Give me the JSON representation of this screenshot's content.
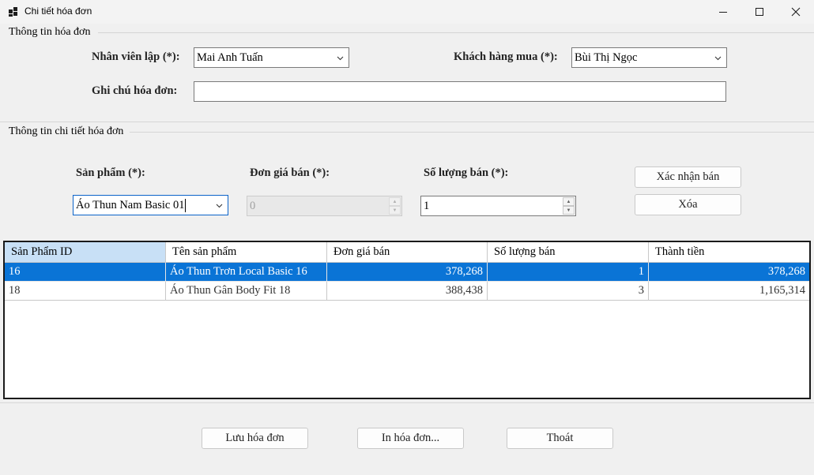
{
  "window": {
    "title": "Chi tiết hóa đơn"
  },
  "invoice_info": {
    "group_title": "Thông tin hóa đơn",
    "employee_label": "Nhân viên lập (*):",
    "employee_value": "Mai Anh Tuấn",
    "customer_label": "Khách hàng mua (*):",
    "customer_value": "Bùi Thị Ngọc",
    "note_label": "Ghi chú hóa đơn:",
    "note_value": ""
  },
  "detail_info": {
    "group_title": "Thông tin chi tiết hóa đơn",
    "product_label": "Sản phẩm (*):",
    "product_value": "Áo Thun Nam Basic 01",
    "price_label": "Đơn giá bán (*):",
    "price_value": "0",
    "qty_label": "Số lượng bán (*):",
    "qty_value": "1",
    "confirm_button": "Xác nhận bán",
    "delete_button": "Xóa"
  },
  "grid": {
    "columns": [
      "Sản Phẩm ID",
      "Tên sản phẩm",
      "Đơn giá bán",
      "Số lượng bán",
      "Thành tiền"
    ],
    "rows": [
      {
        "id": "16",
        "name": "Áo Thun Trơn Local Basic 16",
        "price": "378,268",
        "qty": "1",
        "total": "378,268",
        "selected": true
      },
      {
        "id": "18",
        "name": "Áo Thun Gân Body Fit 18",
        "price": "388,438",
        "qty": "3",
        "total": "1,165,314",
        "selected": false
      }
    ]
  },
  "footer": {
    "save_button": "Lưu hóa đơn",
    "print_button": "In hóa đơn...",
    "exit_button": "Thoát"
  },
  "icons": [
    "app-icon",
    "minimize-icon",
    "maximize-icon",
    "close-icon",
    "chevron-down-icon",
    "spin-up-icon",
    "spin-down-icon"
  ]
}
